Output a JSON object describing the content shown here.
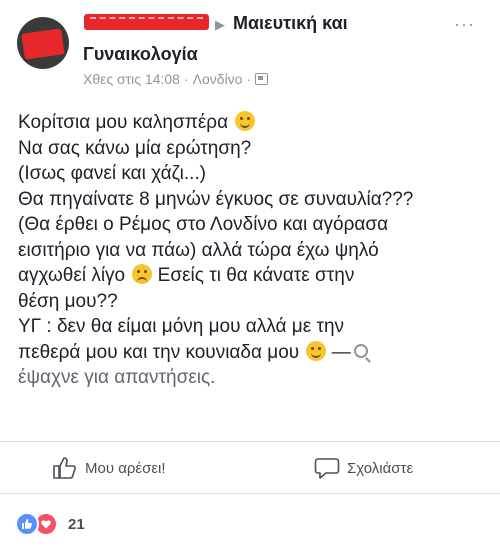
{
  "header": {
    "group_name_line1": "Μαιευτική και",
    "group_name_line2": "Γυναικολογία",
    "timestamp": "Χθες στις 14:08",
    "separator": "·",
    "location": "Λονδίνο",
    "more_label": "···"
  },
  "post": {
    "lines": [
      "Κορίτσια μου καλησπέρα",
      "Να σας κάνω μία  ερώτηση?",
      "(Ισως φανεί και χάζι...)",
      "Θα πηγαίνατε 8 μηνών έγκυος σε συναυλία???",
      "(Θα έρθει ο Ρέμος στο Λονδίνο και αγόρασα",
      "εισιτήριο για να πάω) αλλά τώρα έχω ψηλό",
      "αγχωθεί λίγο",
      "Εσείς τι θα κάνατε στην",
      "θέση μου??",
      "ΥΓ : δεν θα είμαι μόνη μου αλλά με την",
      "πεθερά μου και την κουνιαδα μου",
      "—",
      "έψαχνε για απαντήσεις."
    ]
  },
  "actions": {
    "like_label": "Μου αρέσει!",
    "comment_label": "Σχολιάστε"
  },
  "reactions": {
    "count": "21",
    "types": [
      "like",
      "love"
    ]
  },
  "colors": {
    "text": "#1d2129",
    "meta": "#90949c",
    "like_blue": "#5890ff",
    "love_red": "#f25268",
    "redaction": "#e8272a"
  },
  "icons": [
    "ellipsis-icon",
    "globe-icon",
    "smile-emoji-icon",
    "worried-emoji-icon",
    "magnifier-icon",
    "thumbs-up-icon",
    "comment-bubble-icon",
    "like-reaction-icon",
    "love-reaction-icon"
  ]
}
